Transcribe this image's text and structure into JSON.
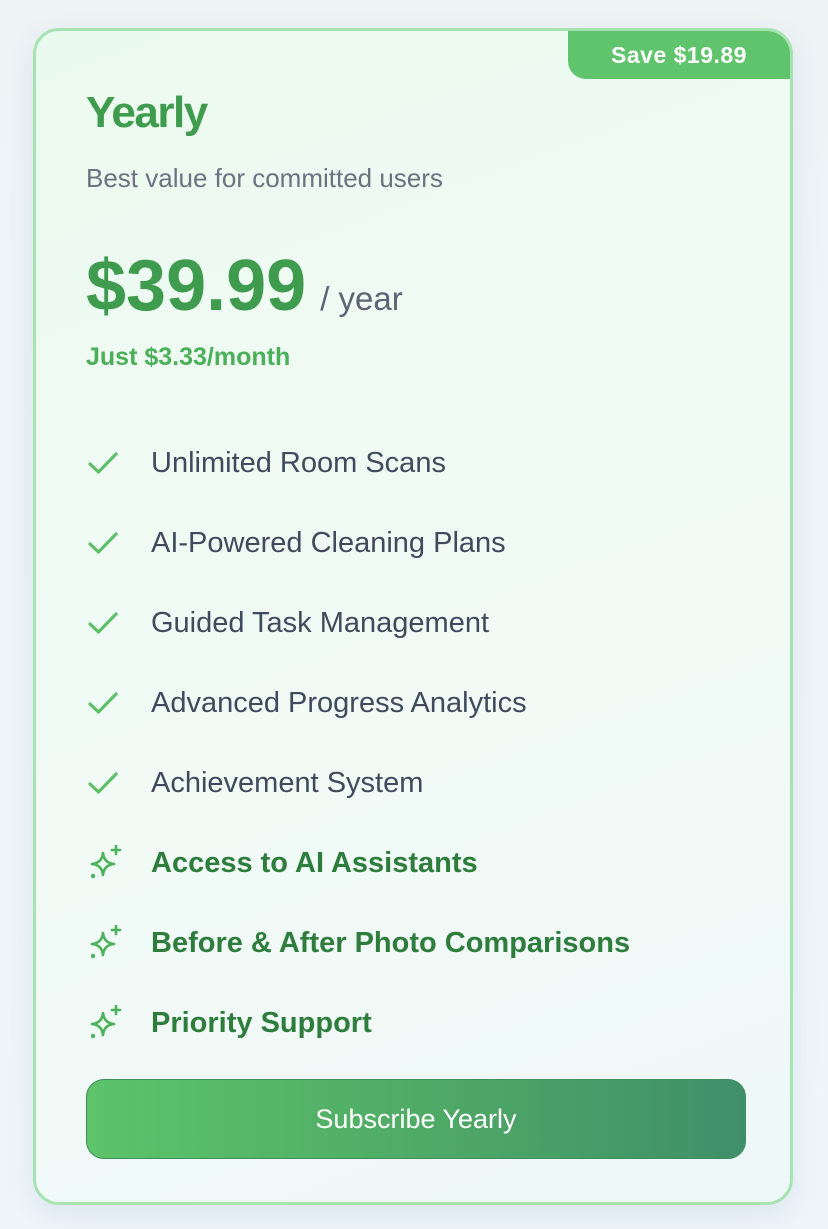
{
  "plan": {
    "badge": "Save $19.89",
    "title": "Yearly",
    "subtitle": "Best value for committed users",
    "price": "$39.99",
    "period": "/ year",
    "monthly_note": "Just $3.33/month"
  },
  "features": [
    {
      "label": "Unlimited Room Scans",
      "icon": "check-icon",
      "premium": false
    },
    {
      "label": "AI-Powered Cleaning Plans",
      "icon": "check-icon",
      "premium": false
    },
    {
      "label": "Guided Task Management",
      "icon": "check-icon",
      "premium": false
    },
    {
      "label": "Advanced Progress Analytics",
      "icon": "check-icon",
      "premium": false
    },
    {
      "label": "Achievement System",
      "icon": "check-icon",
      "premium": false
    },
    {
      "label": "Access to AI Assistants",
      "icon": "sparkle-icon",
      "premium": true
    },
    {
      "label": "Before & After Photo Comparisons",
      "icon": "sparkle-icon",
      "premium": true
    },
    {
      "label": "Priority Support",
      "icon": "sparkle-icon",
      "premium": true
    }
  ],
  "cta": {
    "label": "Subscribe Yearly"
  },
  "colors": {
    "accent": "#3f9b4e",
    "badge": "#5fc46b",
    "border": "#a7e3b0",
    "button_start": "#5dc46a",
    "button_end": "#3f8f6a"
  }
}
